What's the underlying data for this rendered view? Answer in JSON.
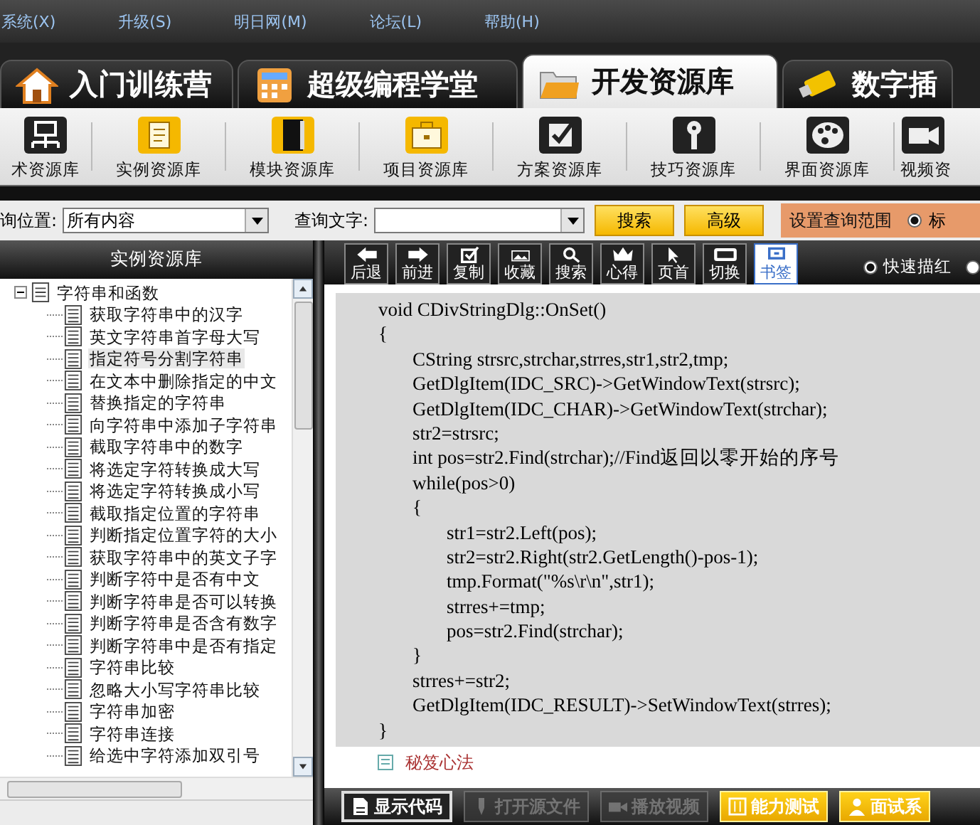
{
  "menu": [
    "系统(X)",
    "升级(S)",
    "明日网(M)",
    "论坛(L)",
    "帮助(H)"
  ],
  "main_tabs": [
    {
      "label": "入门训练营",
      "kind": "house",
      "selected": false
    },
    {
      "label": "超级编程学堂",
      "kind": "calculator",
      "selected": false
    },
    {
      "label": "开发资源库",
      "kind": "folder",
      "selected": true
    },
    {
      "label": "数字插",
      "kind": "usb",
      "selected": false
    }
  ],
  "library_toolbar": [
    {
      "label": "术资源库",
      "kind": "network",
      "selected": false
    },
    {
      "label": "实例资源库",
      "kind": "document",
      "selected": true
    },
    {
      "label": "模块资源库",
      "kind": "book",
      "selected": true
    },
    {
      "label": "项目资源库",
      "kind": "briefcase",
      "selected": true
    },
    {
      "label": "方案资源库",
      "kind": "checkbox",
      "selected": false
    },
    {
      "label": "技巧资源库",
      "kind": "key",
      "selected": false
    },
    {
      "label": "界面资源库",
      "kind": "palette",
      "selected": false
    },
    {
      "label": "视频资",
      "kind": "camera",
      "selected": false
    }
  ],
  "search": {
    "location_label": "询位置:",
    "location_value": "所有内容",
    "text_label": "查询文字:",
    "search_button": "搜索",
    "advanced_button": "高级",
    "scope_label": "设置查询范围",
    "scope_radio": {
      "label": "标",
      "checked": true
    }
  },
  "sidebar": {
    "title": "实例资源库",
    "tree": [
      {
        "label": "字符串和函数",
        "expanded": true,
        "children": [
          {
            "label": "获取字符串中的汉字",
            "selected": false
          },
          {
            "label": "英文字符串首字母大写",
            "selected": false
          },
          {
            "label": "指定符号分割字符串",
            "selected": true
          },
          {
            "label": "在文本中删除指定的中文",
            "selected": false
          },
          {
            "label": "替换指定的字符串",
            "selected": false
          },
          {
            "label": "向字符串中添加子字符串",
            "selected": false
          },
          {
            "label": "截取字符串中的数字",
            "selected": false
          },
          {
            "label": "将选定字符转换成大写",
            "selected": false
          },
          {
            "label": "将选定字符转换成小写",
            "selected": false
          },
          {
            "label": "截取指定位置的字符串",
            "selected": false
          },
          {
            "label": "判断指定位置字符的大小",
            "selected": false
          },
          {
            "label": "获取字符串中的英文子字",
            "selected": false
          },
          {
            "label": "判断字符中是否有中文",
            "selected": false
          },
          {
            "label": "判断字符串是否可以转换",
            "selected": false
          },
          {
            "label": "判断字符串是否含有数字",
            "selected": false
          },
          {
            "label": "判断字符串中是否有指定",
            "selected": false
          },
          {
            "label": "字符串比较",
            "selected": false
          },
          {
            "label": "忽略大小写字符串比较",
            "selected": false
          },
          {
            "label": "字符串加密",
            "selected": false
          },
          {
            "label": "字符串连接",
            "selected": false
          },
          {
            "label": "给选中字符添加双引号",
            "selected": false
          }
        ]
      }
    ]
  },
  "viewer_toolbar": [
    {
      "label": "后退",
      "kind": "left",
      "selected": false
    },
    {
      "label": "前进",
      "kind": "right",
      "selected": false
    },
    {
      "label": "复制",
      "kind": "check",
      "selected": false
    },
    {
      "label": "收藏",
      "kind": "image",
      "selected": false
    },
    {
      "label": "搜索",
      "kind": "search",
      "selected": false
    },
    {
      "label": "心得",
      "kind": "crown",
      "selected": false
    },
    {
      "label": "页首",
      "kind": "cursor",
      "selected": false
    },
    {
      "label": "切换",
      "kind": "rect",
      "selected": false
    },
    {
      "label": "书签",
      "kind": "bookmark",
      "selected": true
    }
  ],
  "viewer_modes": [
    {
      "label": "快速描红",
      "checked": true
    },
    {
      "checked": false
    }
  ],
  "code": [
    "void CDivStringDlg::OnSet()",
    "{",
    "\tCString strsrc,strchar,strres,str1,str2,tmp;",
    "\tGetDlgItem(IDC_SRC)->GetWindowText(strsrc);",
    "\tGetDlgItem(IDC_CHAR)->GetWindowText(strchar);",
    "\tstr2=strsrc;",
    "\tint pos=str2.Find(strchar);//Find返回以零开始的序号",
    "\twhile(pos>0)",
    "\t{",
    "\t\tstr1=str2.Left(pos);",
    "\t\tstr2=str2.Right(str2.GetLength()-pos-1);",
    "\t\ttmp.Format(\"%s\\r\\n\",str1);",
    "\t\tstrres+=tmp;",
    "\t\tpos=str2.Find(strchar);",
    "\t}",
    "\tstrres+=str2;",
    "\tGetDlgItem(IDC_RESULT)->SetWindowText(strres);",
    "}"
  ],
  "section_heading": "秘笈心法",
  "bottom_buttons": [
    {
      "label": "显示代码",
      "kind": "active",
      "disabled": false
    },
    {
      "label": "打开源文件",
      "kind": "dark",
      "disabled": true
    },
    {
      "label": "播放视频",
      "kind": "dark",
      "disabled": true
    },
    {
      "label": "能力测试",
      "kind": "yellow",
      "disabled": false
    },
    {
      "label": "面试系",
      "kind": "yellow",
      "disabled": false
    }
  ]
}
